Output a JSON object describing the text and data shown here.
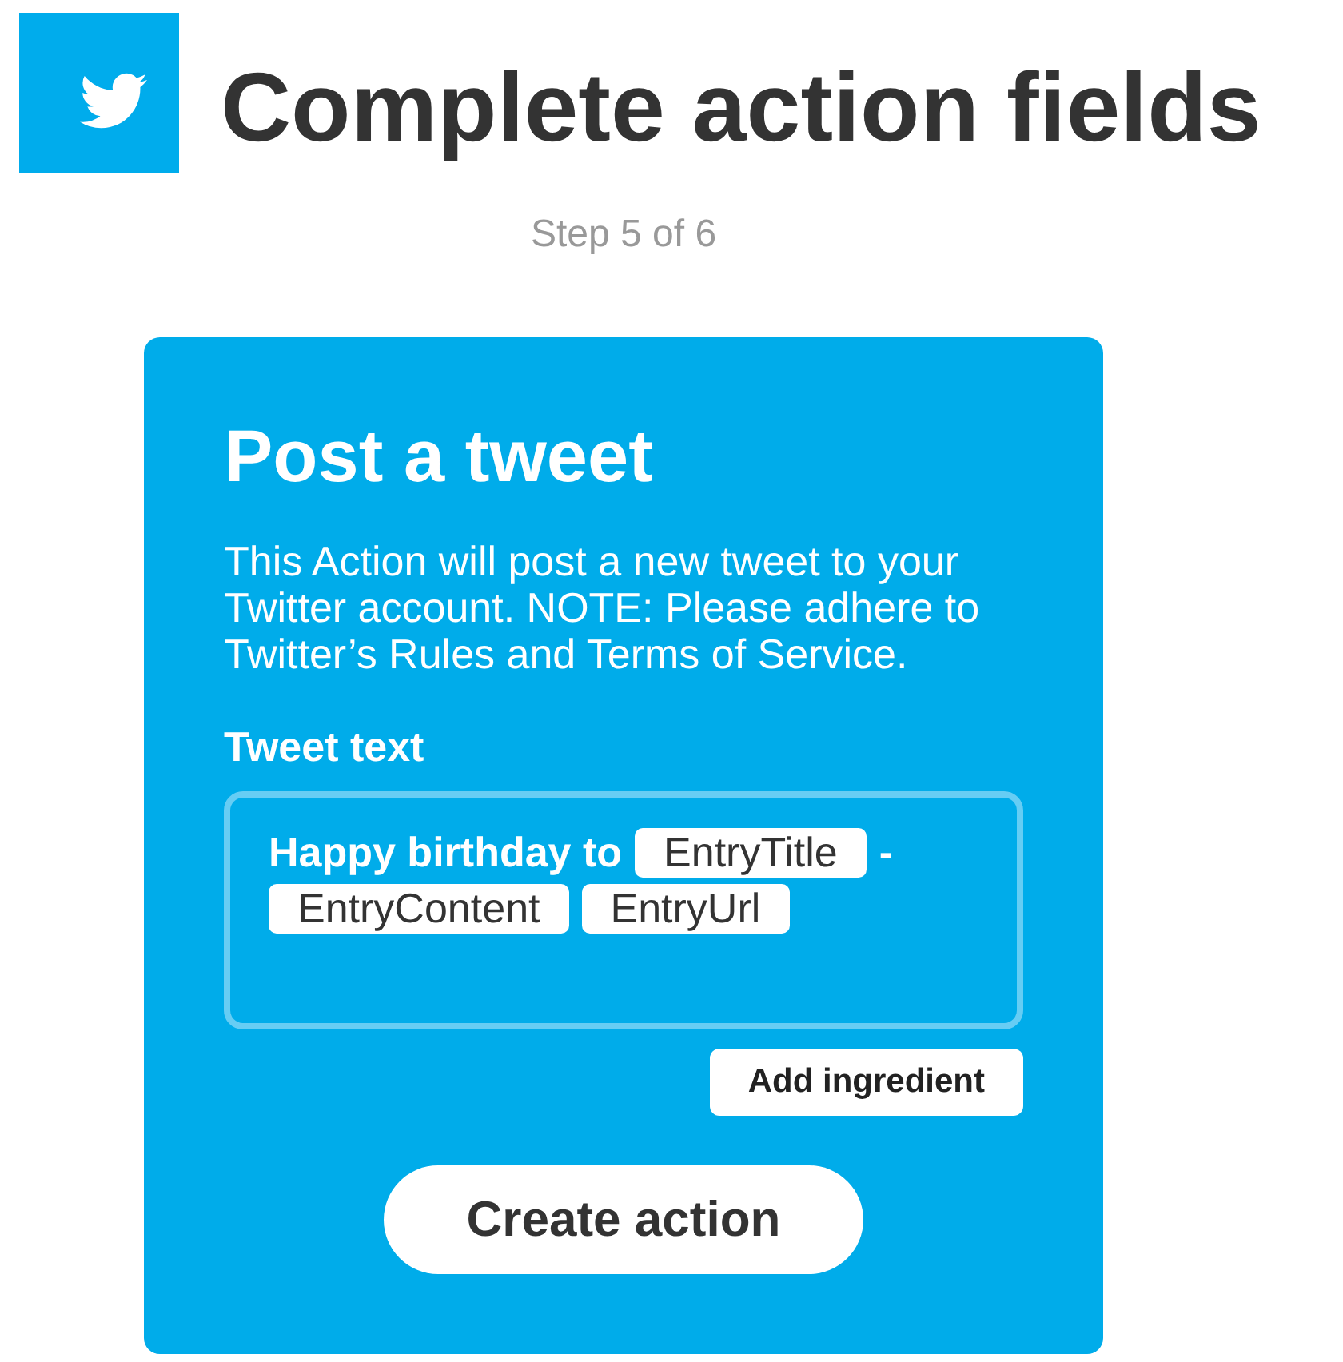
{
  "header": {
    "title": "Complete action fields",
    "step": "Step 5 of 6"
  },
  "card": {
    "title": "Post a tweet",
    "description": "This Action will post a new tweet to your Twitter account. NOTE: Please adhere to Twitter’s Rules and Terms of Service.",
    "field": {
      "label": "Tweet text",
      "value": [
        {
          "kind": "text",
          "text": "Happy birthday to"
        },
        {
          "kind": "ingredient",
          "text": "EntryTitle"
        },
        {
          "kind": "text",
          "text": "-"
        },
        {
          "kind": "ingredient",
          "text": "EntryContent"
        },
        {
          "kind": "ingredient",
          "text": "EntryUrl"
        }
      ]
    },
    "add_button": "Add ingredient",
    "submit_button": "Create action"
  }
}
